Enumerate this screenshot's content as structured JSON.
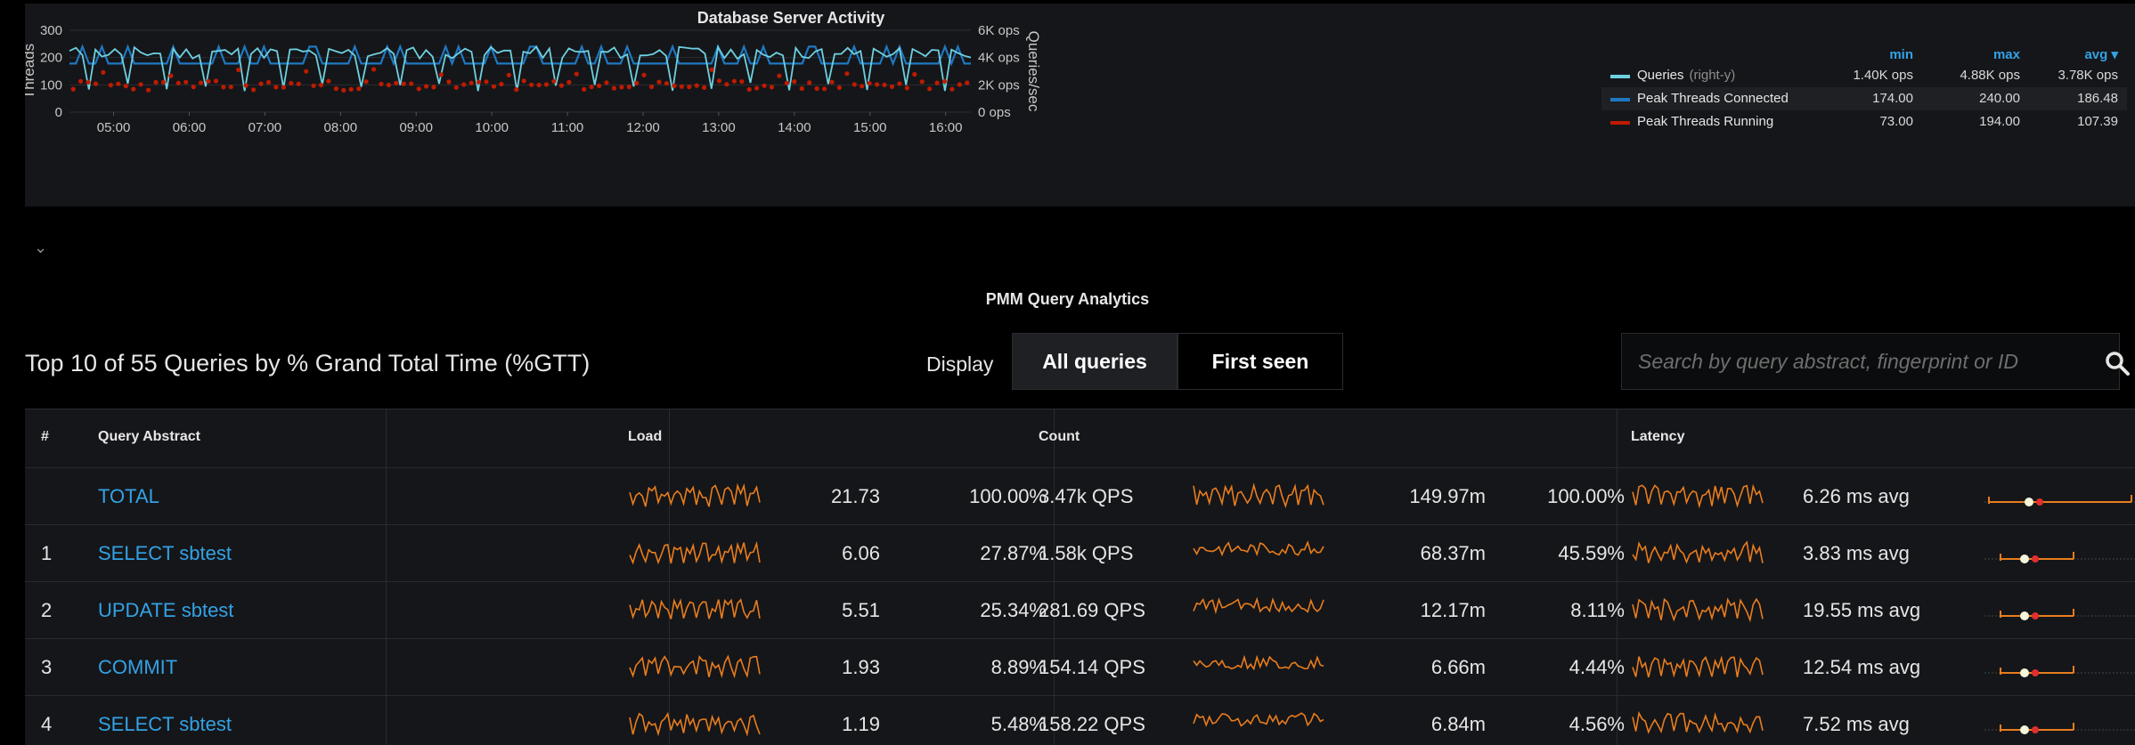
{
  "graph": {
    "title": "Database Server Activity",
    "left_axis_label": "Threads",
    "right_axis_label": "Queries/sec",
    "left_ticks": [
      "300",
      "200",
      "100",
      "0"
    ],
    "right_ticks": [
      "6K ops",
      "4K ops",
      "2K ops",
      "0 ops"
    ],
    "time_ticks": [
      "05:00",
      "06:00",
      "07:00",
      "08:00",
      "09:00",
      "10:00",
      "11:00",
      "12:00",
      "13:00",
      "14:00",
      "15:00",
      "16:00"
    ],
    "legend": {
      "headers": {
        "min": "min",
        "max": "max",
        "avg": "avg ▾"
      },
      "series": [
        {
          "name": "Queries",
          "note": "(right-y)",
          "color": "#6ed0e0",
          "min": "1.40K ops",
          "max": "4.88K ops",
          "avg": "3.78K ops"
        },
        {
          "name": "Peak Threads Connected",
          "note": "",
          "color": "#1f78c1",
          "min": "174.00",
          "max": "240.00",
          "avg": "186.48"
        },
        {
          "name": "Peak Threads Running",
          "note": "",
          "color": "#bf1b00",
          "min": "73.00",
          "max": "194.00",
          "avg": "107.39"
        }
      ]
    }
  },
  "chart_data": {
    "type": "line",
    "xlabel": "",
    "ylabel": "Threads",
    "y2label": "Queries/sec",
    "ylim": [
      0,
      300
    ],
    "y2lim": [
      0,
      6000
    ],
    "x_range": [
      "04:25",
      "16:20"
    ],
    "series": [
      {
        "name": "Queries",
        "axis": "right",
        "kind": "line",
        "min": 1400,
        "max": 4880,
        "avg": 3780
      },
      {
        "name": "Peak Threads Connected",
        "axis": "left",
        "kind": "line",
        "min": 174,
        "max": 240,
        "avg": 186.48
      },
      {
        "name": "Peak Threads Running",
        "axis": "left",
        "kind": "points",
        "min": 73,
        "max": 194,
        "avg": 107.39
      }
    ]
  },
  "qan": {
    "title": "PMM Query Analytics",
    "top_label": "Top 10 of 55 Queries by % Grand Total Time (%GTT)",
    "display_label": "Display",
    "btn_all": "All queries",
    "btn_first": "First seen",
    "search_placeholder": "Search by query abstract, fingerprint or ID",
    "headers": {
      "idx": "#",
      "abstract": "Query Abstract",
      "load": "Load",
      "count": "Count",
      "latency": "Latency"
    },
    "rows": [
      {
        "idx": "",
        "abstract": "TOTAL",
        "load": "21.73",
        "load_pct": "100.00%",
        "qps": "3.47k QPS",
        "count": "149.97m",
        "count_pct": "100.00%",
        "latency": "6.26 ms avg"
      },
      {
        "idx": "1",
        "abstract": "SELECT sbtest",
        "load": "6.06",
        "load_pct": "27.87%",
        "qps": "1.58k QPS",
        "count": "68.37m",
        "count_pct": "45.59%",
        "latency": "3.83 ms avg"
      },
      {
        "idx": "2",
        "abstract": "UPDATE sbtest",
        "load": "5.51",
        "load_pct": "25.34%",
        "qps": "281.69 QPS",
        "count": "12.17m",
        "count_pct": "8.11%",
        "latency": "19.55 ms avg"
      },
      {
        "idx": "3",
        "abstract": "COMMIT",
        "load": "1.93",
        "load_pct": "8.89%",
        "qps": "154.14 QPS",
        "count": "6.66m",
        "count_pct": "4.44%",
        "latency": "12.54 ms avg"
      },
      {
        "idx": "4",
        "abstract": "SELECT sbtest",
        "load": "1.19",
        "load_pct": "5.48%",
        "qps": "158.22 QPS",
        "count": "6.84m",
        "count_pct": "4.56%",
        "latency": "7.52 ms avg"
      }
    ]
  }
}
